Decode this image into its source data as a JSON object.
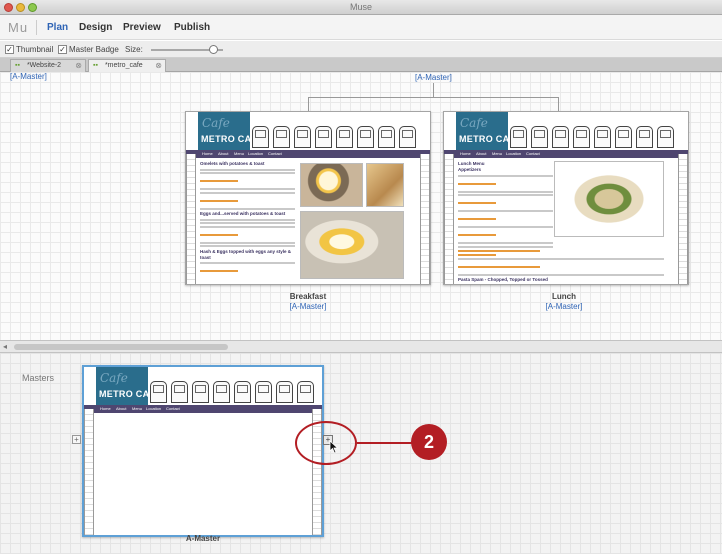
{
  "window": {
    "title": "Muse"
  },
  "menubar": {
    "logo": "Mu",
    "items": [
      {
        "label": "Plan",
        "active": true
      },
      {
        "label": "Design",
        "active": false
      },
      {
        "label": "Preview",
        "active": false
      },
      {
        "label": "Publish",
        "active": false
      }
    ]
  },
  "toolbar": {
    "thumbnail_label": "Thumbnail",
    "thumbnail_checked": true,
    "master_badge_label": "Master Badge",
    "master_badge_checked": true,
    "size_label": "Size:"
  },
  "tabs": [
    {
      "label": "*Website-2",
      "active": false,
      "close": "⊗"
    },
    {
      "label": "*metro_cafe",
      "active": true,
      "close": "⊗"
    }
  ],
  "plan": {
    "root_master_left": "[A-Master]",
    "root_master_center": "[A-Master]",
    "pages": [
      {
        "name": "Breakfast",
        "master": "[A-Master]"
      },
      {
        "name": "Lunch",
        "master": "[A-Master]"
      }
    ],
    "site_brand": {
      "script": "Cafe",
      "name": "METRO CAFE"
    },
    "nav": [
      "Home",
      "About",
      "Menu",
      "Location",
      "Contact"
    ],
    "breakfast_headings": [
      "Omelets with potatoes & toast",
      "Eggs and...served with potatoes & toast",
      "Hash & Eggs topped with eggs any style & toast"
    ],
    "lunch_headings": [
      "Lunch Menu",
      "Appetizers",
      "Pasta Spam - Chopped, Topped or Tossed"
    ]
  },
  "masters": {
    "title": "Masters",
    "items": [
      {
        "name": "A-Master"
      }
    ],
    "add_left": "+",
    "add_right": "+"
  },
  "callout": {
    "number": "2",
    "color": "#b31e24"
  },
  "colors": {
    "accent": "#2f64b5",
    "header_blue": "#2a6d8c",
    "nav_purple": "#4f4670",
    "selection": "#5ea0d6"
  }
}
